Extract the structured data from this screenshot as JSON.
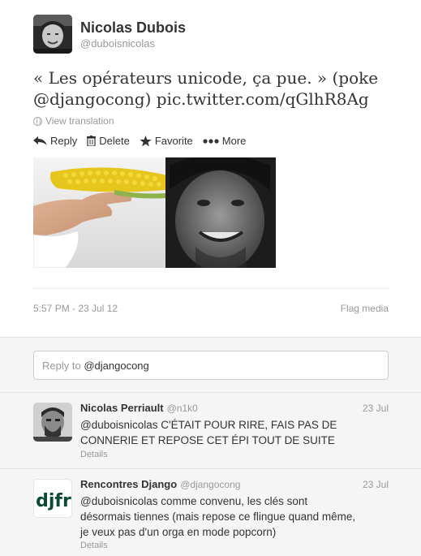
{
  "tweet": {
    "author_name": "Nicolas Dubois",
    "author_handle": "@duboisnicolas",
    "text": "« Les opérateurs unicode, ça pue. » (poke @djangocong) pic.twitter.com/qGlhR8Ag",
    "view_translation": "View translation",
    "actions": {
      "reply": "Reply",
      "delete": "Delete",
      "favorite": "Favorite",
      "more": "More"
    },
    "timestamp": "5:57 PM - 23 Jul 12",
    "flag_media": "Flag media"
  },
  "reply_box": {
    "placeholder_prefix": "Reply to",
    "mention": "@djangocong"
  },
  "replies": [
    {
      "name": "Nicolas Perriault",
      "handle": "@n1k0",
      "date": "23 Jul",
      "text": "@duboisnicolas C'ÉTAIT POUR RIRE, FAIS PAS DE CONNERIE ET REPOSE CET ÉPI TOUT DE SUITE",
      "details": "Details"
    },
    {
      "name": "Rencontres Django",
      "handle": "@djangocong",
      "date": "23 Jul",
      "text": "@duboisnicolas comme convenu, les clés sont désormais tiennes (mais repose ce flingue quand même, je veux pas d'un orga en mode popcorn)",
      "details": "Details",
      "logo_text": "djfr"
    }
  ],
  "colors": {
    "corn": "#e6c51c",
    "djfr_green": "#0c4b33",
    "muted": "#999999"
  }
}
